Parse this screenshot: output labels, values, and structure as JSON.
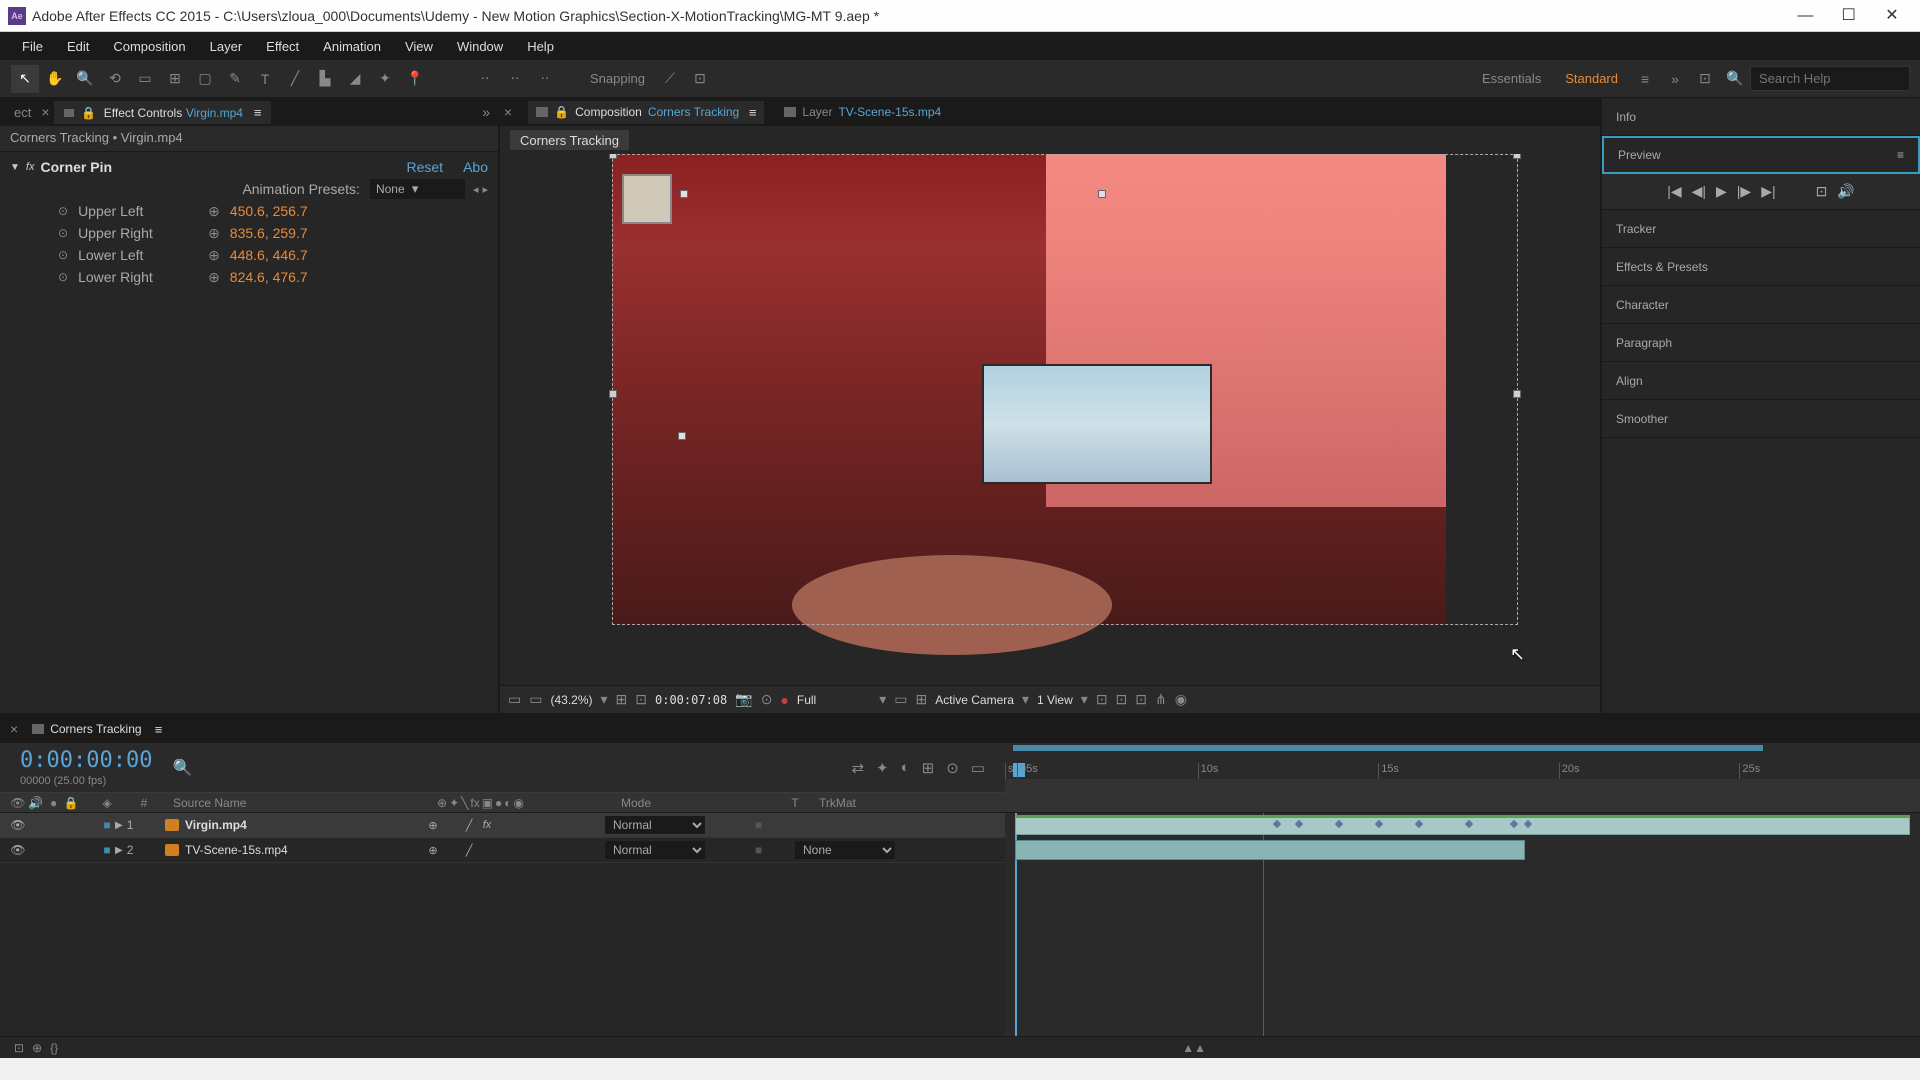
{
  "titlebar": {
    "app_icon_text": "Ae",
    "title": "Adobe After Effects CC 2015 - C:\\Users\\zloua_000\\Documents\\Udemy - New Motion Graphics\\Section-X-MotionTracking\\MG-MT 9.aep *"
  },
  "menu": {
    "file": "File",
    "edit": "Edit",
    "composition": "Composition",
    "layer": "Layer",
    "effect": "Effect",
    "animation": "Animation",
    "view": "View",
    "window": "Window",
    "help": "Help"
  },
  "toolbar": {
    "snapping": "Snapping",
    "workspace_essentials": "Essentials",
    "workspace_standard": "Standard",
    "search_placeholder": "Search Help"
  },
  "left_tabs": {
    "project": "ect",
    "effect_controls": "Effect Controls",
    "effect_controls_layer": "Virgin.mp4"
  },
  "breadcrumb": "Corners Tracking • Virgin.mp4",
  "effect": {
    "name": "Corner Pin",
    "reset": "Reset",
    "about": "Abo",
    "presets_label": "Animation Presets:",
    "presets_value": "None",
    "props": [
      {
        "name": "Upper Left",
        "value": "450.6, 256.7"
      },
      {
        "name": "Upper Right",
        "value": "835.6, 259.7"
      },
      {
        "name": "Lower Left",
        "value": "448.6, 446.7"
      },
      {
        "name": "Lower Right",
        "value": "824.6, 476.7"
      }
    ]
  },
  "center_tabs": {
    "comp_prefix": "Composition",
    "comp_name": "Corners Tracking",
    "layer_prefix": "Layer",
    "layer_name": "TV-Scene-15s.mp4"
  },
  "comp_crumb": "Corners Tracking",
  "viewer_controls": {
    "zoom": "(43.2%)",
    "time": "0:00:07:08",
    "quality": "Full",
    "camera": "Active Camera",
    "views": "1 View"
  },
  "right_panels": {
    "info": "Info",
    "preview": "Preview",
    "tracker": "Tracker",
    "effects_presets": "Effects & Presets",
    "character": "Character",
    "paragraph": "Paragraph",
    "align": "Align",
    "smoother": "Smoother"
  },
  "timeline": {
    "tab_name": "Corners Tracking",
    "timecode": "0:00:00:00",
    "fps": "00000 (25.00 fps)",
    "ticks": [
      "s",
      "05s",
      "10s",
      "15s",
      "20s",
      "25s"
    ],
    "col_num": "#",
    "col_src": "Source Name",
    "col_mode": "Mode",
    "col_trk": "T",
    "col_trkmat": "TrkMat",
    "layers": [
      {
        "num": "1",
        "src": "Virgin.mp4",
        "mode": "Normal"
      },
      {
        "num": "2",
        "src": "TV-Scene-15s.mp4",
        "mode": "Normal",
        "trkmat": "None"
      }
    ]
  },
  "statusbar": {
    "braces": "{}"
  }
}
